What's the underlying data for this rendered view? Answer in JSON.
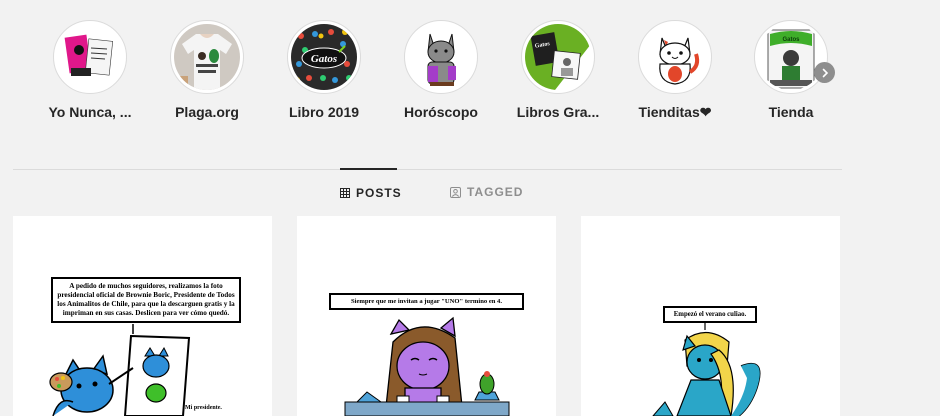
{
  "highlights": [
    {
      "label": "Yo Nunca, ...",
      "icon": "pink-book-cover"
    },
    {
      "label": "Plaga.org",
      "icon": "t-shirt-print"
    },
    {
      "label": "Libro 2019",
      "icon": "gatos-book-cover"
    },
    {
      "label": "Horóscopo",
      "icon": "horoscope-cat"
    },
    {
      "label": "Libros Gra...",
      "icon": "green-book-cover"
    },
    {
      "label": "Tienditas❤",
      "icon": "white-cat-mug"
    },
    {
      "label": "Tienda",
      "icon": "green-cats-poster"
    }
  ],
  "tabs": {
    "posts": "POSTS",
    "tagged": "TAGGED"
  },
  "posts": [
    {
      "caption": "A pedido de muchos seguidores, realizamos la foto presidencial oficial de Brownie Boric, Presidente de Todos los Animalitos de Chile, para que la descarguen gratis y la impriman en sus casas. Deslicen para ver cómo quedó.",
      "small_text": "Mi presidente."
    },
    {
      "caption": "Siempre que me invitan a jugar \"UNO\" termino en 4."
    },
    {
      "caption": "Empezó el verano culiao."
    }
  ],
  "colors": {
    "background": "#f2f2f2",
    "text": "#262626",
    "muted": "#8e8e8e",
    "cat_blue": "#2e8fd9",
    "cat_purple": "#b57ae8",
    "cat_teal": "#2aa6c8"
  }
}
